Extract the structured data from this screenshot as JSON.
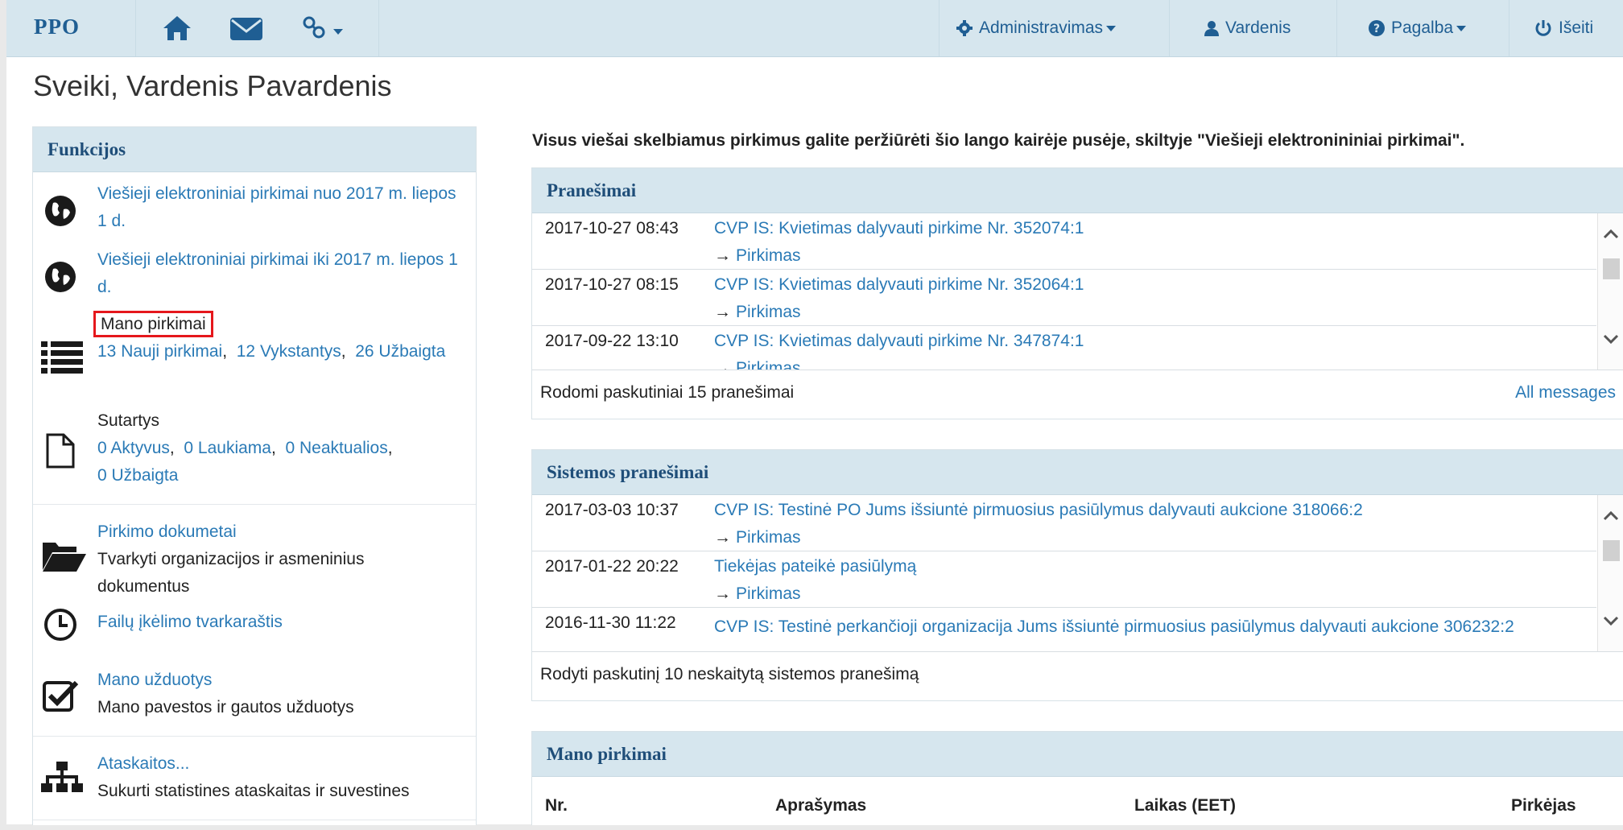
{
  "navbar": {
    "brand": "PPO",
    "admin_label": "Administravimas",
    "user_label": "Vardenis",
    "help_label": "Pagalba",
    "logout_label": "Išeiti"
  },
  "greeting": "Sveiki, Vardenis Pavardenis",
  "functions": {
    "title": "Funkcijos",
    "items": [
      {
        "link": "Viešieji elektroniniai pirkimai nuo 2017 m. liepos 1 d."
      },
      {
        "link": "Viešieji elektroniniai pirkimai iki 2017 m. liepos 1 d."
      },
      {
        "label": "Mano pirkimai",
        "new": "13 Nauji pirkimai",
        "ongoing": "12 Vykstantys",
        "done": "26 Užbaigta"
      },
      {
        "label": "Sutartys",
        "active": "0 Aktyvus",
        "waiting": "0 Laukiama",
        "inactive": "0 Neaktualios",
        "done": "0 Užbaigta"
      },
      {
        "link": "Pirkimo dokumetai",
        "desc": "Tvarkyti organizacijos ir asmeninius dokumentus"
      },
      {
        "link": "Failų įkėlimo tvarkaraštis"
      },
      {
        "link": "Mano užduotys",
        "desc": "Mano pavestos ir gautos užduotys"
      },
      {
        "link": "Ataskaitos...",
        "desc": "Sukurti statistines ataskaitas ir suvestines"
      }
    ],
    "separator": ","
  },
  "intro": "Visus viešai skelbiamus pirkimus galite peržiūrėti šio lango kairėje pusėje, skiltyje \"Viešieji elektronininiai pirkimai\".",
  "notifications": {
    "title": "Pranešimai",
    "rows": [
      {
        "date": "2017-10-27 08:43",
        "title": "CVP IS: Kvietimas dalyvauti pirkime Nr. 352074:1",
        "sub": "Pirkimas"
      },
      {
        "date": "2017-10-27 08:15",
        "title": "CVP IS: Kvietimas dalyvauti pirkime Nr. 352064:1",
        "sub": "Pirkimas"
      },
      {
        "date": "2017-09-22 13:10",
        "title": "CVP IS: Kvietimas dalyvauti pirkime Nr. 347874:1",
        "sub": "Pirkimas"
      }
    ],
    "footer_left": "Rodomi paskutiniai 15 pranešimai",
    "footer_right": "All messages"
  },
  "system_notifications": {
    "title": "Sistemos pranešimai",
    "rows": [
      {
        "date": "2017-03-03 10:37",
        "title": "CVP IS: Testinė PO Jums išsiuntė pirmuosius pasiūlymus dalyvauti aukcione 318066:2",
        "sub": "Pirkimas"
      },
      {
        "date": "2017-01-22 20:22",
        "title": "Tiekėjas pateikė pasiūlymą",
        "sub": "Pirkimas"
      },
      {
        "date": "2016-11-30 11:22",
        "title": "CVP IS: Testinė perkančioji organizacija Jums išsiuntė pirmuosius pasiūlymus dalyvauti aukcione 306232:2",
        "sub": ""
      }
    ],
    "footer_left": "Rodyti paskutinį 10 neskaitytą sistemos pranešimą"
  },
  "my_purchases": {
    "title": "Mano pirkimai",
    "columns": [
      "Nr.",
      "Aprašymas",
      "Laikas (EET)",
      "Pirkėjas"
    ]
  },
  "arrow": "→"
}
